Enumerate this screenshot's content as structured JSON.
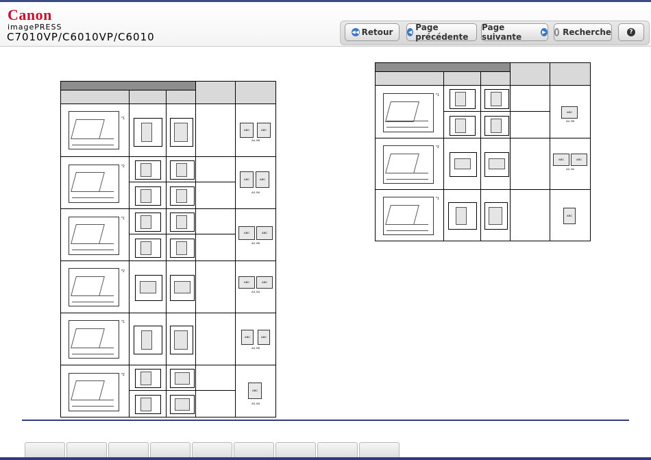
{
  "header": {
    "brand": "Canon",
    "product_line": "imagePRESS",
    "model": "C7010VP/C6010VP/C6010"
  },
  "nav": {
    "back_label": "Retour",
    "prev_label": "Page précédente",
    "next_label": "Page suivante",
    "search_label": "Recherche",
    "help_symbol": "?"
  },
  "left_table": {
    "rows": [
      {
        "note": "*1",
        "label": "A4, B5"
      },
      {
        "note": "*2",
        "label": "A3, B4"
      },
      {
        "note": "*1",
        "label": "A4, B5"
      },
      {
        "note": "*2",
        "label": "A3, B4"
      },
      {
        "note": "*1",
        "label": "A4, B5"
      },
      {
        "note": "*2",
        "label": "A3, B4"
      }
    ]
  },
  "right_table": {
    "rows": [
      {
        "note": "*1",
        "label": "A4, B5"
      },
      {
        "note": "*2",
        "label": "A3, B4"
      },
      {
        "note": "*1",
        "label": ""
      }
    ]
  },
  "sheet_text": "ABC",
  "colors": {
    "accent": "#2f3a7a",
    "brand": "#c8102e",
    "button_icon": "#3a78c6"
  }
}
